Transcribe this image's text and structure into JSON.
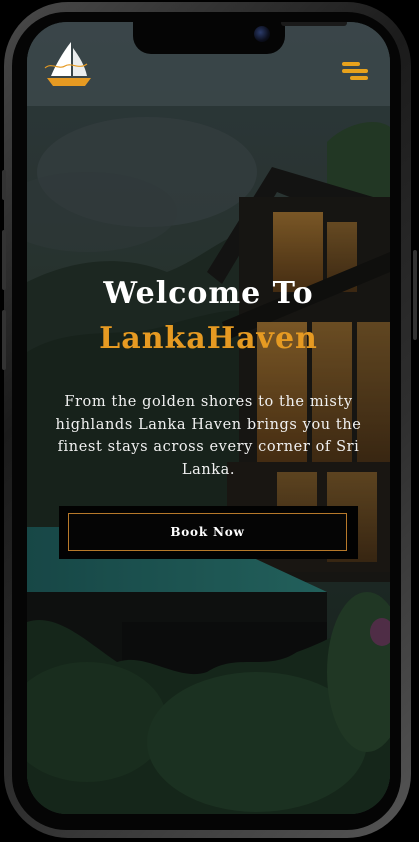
{
  "app": {
    "logo_icon": "lanka-haven-sailboat-logo-icon",
    "menu_icon": "hamburger-menu-icon",
    "accent_color": "#e69a22"
  },
  "hero": {
    "title_line1": "Welcome To",
    "title_line2": "LankaHaven",
    "description": "From the golden shores to the misty highlands Lanka Haven brings you the finest stays across every corner of Sri Lanka.",
    "cta_label": "Book Now",
    "background": "luxury-villa-with-infinity-pool-in-jungle"
  }
}
